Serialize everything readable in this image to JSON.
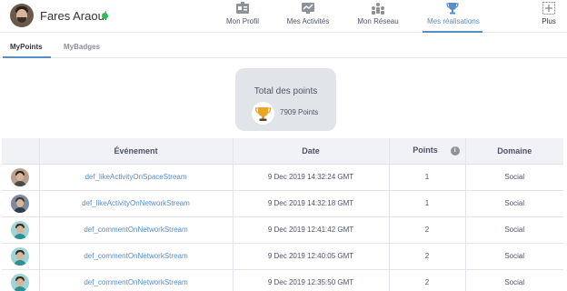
{
  "user": {
    "name": "Fares Araoui",
    "status": "online"
  },
  "nav": {
    "items": [
      {
        "label": "Mon Profil",
        "icon": "profile-card-icon"
      },
      {
        "label": "Mes Activités",
        "icon": "activity-chart-icon"
      },
      {
        "label": "Mon Réseau",
        "icon": "network-icon"
      },
      {
        "label": "Mes réalisations",
        "icon": "trophy-icon",
        "active": true
      },
      {
        "label": "Plus",
        "icon": "plus-box-icon"
      }
    ]
  },
  "subtabs": [
    {
      "label": "MyPoints",
      "active": true
    },
    {
      "label": "MyBadges",
      "active": false
    }
  ],
  "total": {
    "title": "Total des points",
    "value": "7909 Points",
    "icon": "trophy-icon"
  },
  "table": {
    "headers": {
      "event": "Événement",
      "date": "Date",
      "points": "Points",
      "domain": "Domaine"
    },
    "rows": [
      {
        "event": "def_likeActivityOnSpaceStream",
        "date": "9 Dec 2019 14:32:24 GMT",
        "points": "1",
        "domain": "Social",
        "avatar": "man-beard"
      },
      {
        "event": "def_likeActivityOnNetworkStream",
        "date": "9 Dec 2019 14:32:18 GMT",
        "points": "1",
        "domain": "Social",
        "avatar": "man-glasses"
      },
      {
        "event": "def_commentOnNetworkStream",
        "date": "9 Dec 2019 12:41:42 GMT",
        "points": "2",
        "domain": "Social",
        "avatar": "woman-teal"
      },
      {
        "event": "def_commentOnNetworkStream",
        "date": "9 Dec 2019 12:40:05 GMT",
        "points": "2",
        "domain": "Social",
        "avatar": "woman-teal"
      },
      {
        "event": "def_commentOnNetworkStream",
        "date": "9 Dec 2019 12:35:50 GMT",
        "points": "2",
        "domain": "Social",
        "avatar": "woman-teal"
      }
    ]
  },
  "colors": {
    "accent": "#578dc9",
    "online": "#2ebd59",
    "card": "#e1e4e8",
    "header_bg": "#f0f2f5"
  }
}
